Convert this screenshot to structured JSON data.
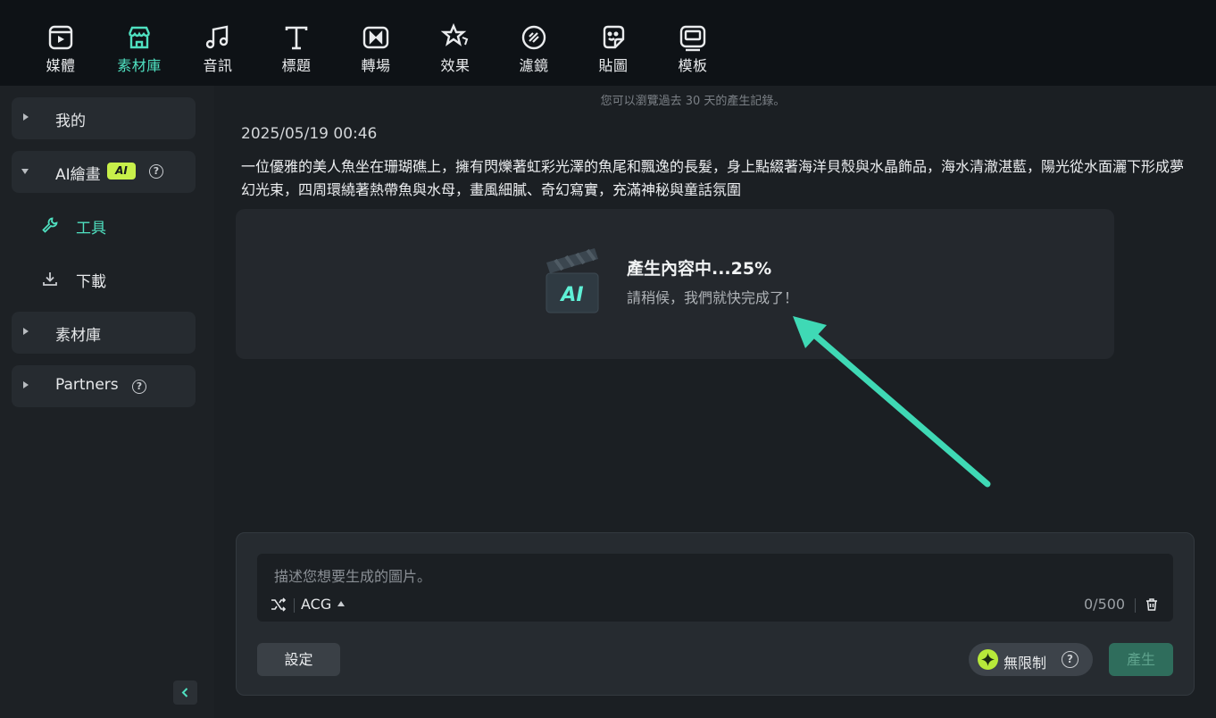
{
  "toolbar": {
    "tabs": [
      {
        "label": "媒體",
        "icon": "media-icon"
      },
      {
        "label": "素材庫",
        "icon": "store-icon",
        "active": true
      },
      {
        "label": "音訊",
        "icon": "music-note-icon"
      },
      {
        "label": "標題",
        "icon": "text-t-icon"
      },
      {
        "label": "轉場",
        "icon": "transition-icon"
      },
      {
        "label": "效果",
        "icon": "effects-star-icon"
      },
      {
        "label": "濾鏡",
        "icon": "filter-icon"
      },
      {
        "label": "貼圖",
        "icon": "sticker-icon"
      },
      {
        "label": "模板",
        "icon": "template-icon"
      }
    ]
  },
  "sidebar": {
    "mine": "我的",
    "ai_drawing": "AI繪畫",
    "ai_badge": "AI",
    "help": "?",
    "tools": "工具",
    "download": "下載",
    "library": "素材庫",
    "partners": "Partners"
  },
  "main": {
    "history_note": "您可以瀏覽過去 30 天的產生記錄。",
    "timestamp": "2025/05/19 00:46",
    "prompt": "一位優雅的美人魚坐在珊瑚礁上，擁有閃爍著虹彩光澤的魚尾和飄逸的長髮，身上點綴著海洋貝殼與水晶飾品，海水清澈湛藍，陽光從水面灑下形成夢幻光束，四周環繞著熱帶魚與水母，畫風細膩、奇幻寫實，充滿神秘與童話氛圍",
    "generating_title": "產生內容中...25%",
    "generating_sub": "請稍候，我們就快完成了！",
    "progress": 25,
    "clapper_label": "AI"
  },
  "composer": {
    "placeholder": "描述您想要生成的圖片。",
    "style": "ACG",
    "counter": "0/500",
    "settings": "設定",
    "unlimited": "無限制",
    "generate": "產生"
  },
  "colors": {
    "accent": "#4fe0c0",
    "badge": "#c8f04a",
    "arrow": "#3fd9b5"
  }
}
